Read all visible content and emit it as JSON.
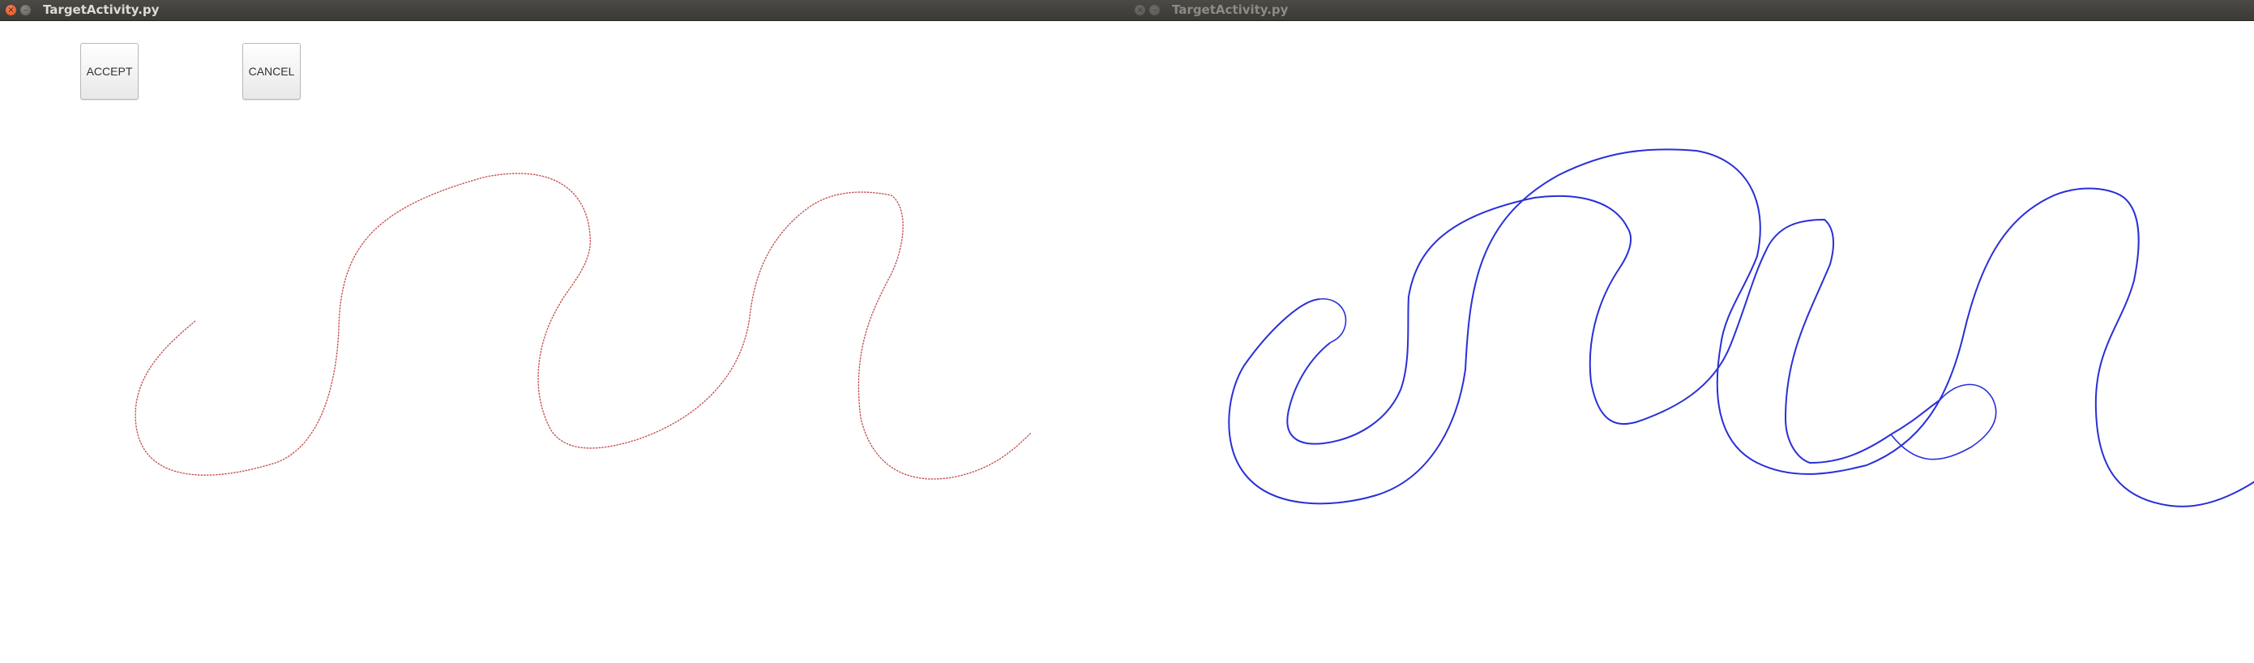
{
  "left_window": {
    "title": "TargetActivity.py",
    "controls": {
      "close_glyph": "×",
      "minimize_glyph": "–"
    },
    "buttons": {
      "accept_label": "ACCEPT",
      "cancel_label": "CANCEL"
    },
    "trace_color": "#c44a4a"
  },
  "right_window": {
    "title": "TargetActivity.py",
    "controls": {
      "close_glyph": "×",
      "minimize_glyph": "–"
    },
    "track_color": "#2a2fd8"
  }
}
